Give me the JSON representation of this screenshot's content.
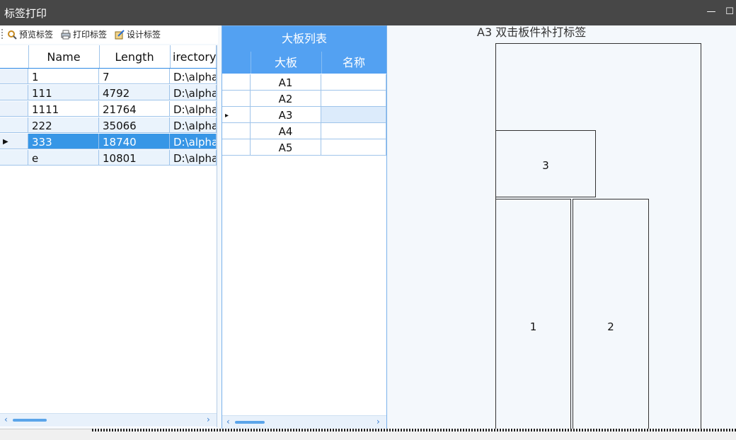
{
  "window": {
    "title": "标签打印",
    "min_glyph": "—",
    "max_glyph": "☐"
  },
  "toolbar": {
    "preview": "预览标签",
    "print": "打印标签",
    "design": "设计标签"
  },
  "file_grid": {
    "columns": [
      "",
      "Name",
      "Length",
      "irectoryN"
    ],
    "rows": [
      {
        "marker": "",
        "name": "1",
        "length": "7",
        "dir": "D:\\alpha"
      },
      {
        "marker": "",
        "name": "111",
        "length": "4792",
        "dir": "D:\\alpha"
      },
      {
        "marker": "",
        "name": "1111",
        "length": "21764",
        "dir": "D:\\alpha"
      },
      {
        "marker": "",
        "name": "222",
        "length": "35066",
        "dir": "D:\\alpha"
      },
      {
        "marker": "▶",
        "name": "333",
        "length": "18740",
        "dir": "D:\\alpha"
      },
      {
        "marker": "",
        "name": "e",
        "length": "10801",
        "dir": "D:\\alpha"
      }
    ],
    "selected_row": 4
  },
  "board_grid": {
    "title": "大板列表",
    "columns": [
      "",
      "大板",
      "名称"
    ],
    "rows": [
      {
        "marker": "",
        "board": "A1",
        "name": ""
      },
      {
        "marker": "",
        "board": "A2",
        "name": ""
      },
      {
        "marker": "▸",
        "board": "A3",
        "name": ""
      },
      {
        "marker": "",
        "board": "A4",
        "name": ""
      },
      {
        "marker": "",
        "board": "A5",
        "name": ""
      }
    ],
    "selected_row": 2
  },
  "canvas": {
    "hint": "A3 双击板件补打标签",
    "parts": [
      "3",
      "1",
      "2"
    ]
  },
  "scroll": {
    "left": "‹",
    "right": "›"
  },
  "colors": {
    "accent": "#53a1f2",
    "selection": "#3796e6",
    "titlebar": "#474747"
  }
}
